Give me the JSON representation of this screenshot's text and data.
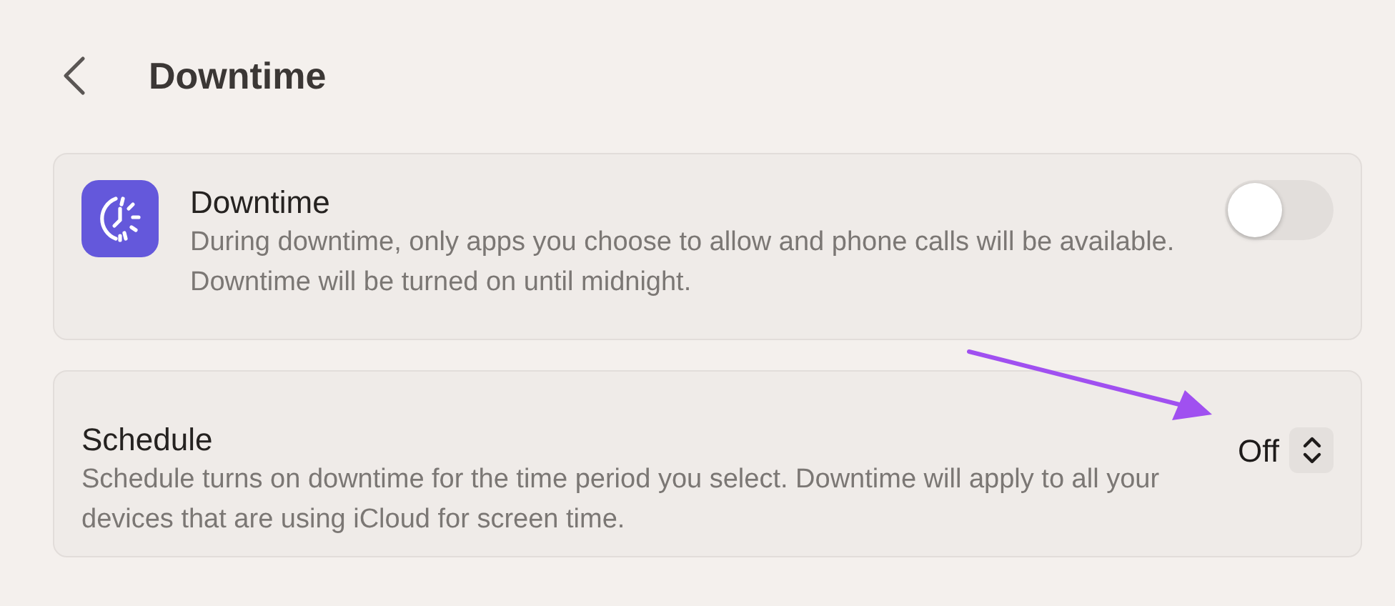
{
  "header": {
    "title": "Downtime"
  },
  "settings": [
    {
      "kind": "toggle",
      "title": "Downtime",
      "description": "During downtime, only apps you choose to allow and phone calls will be available. Downtime will be turned on until midnight.",
      "on": false
    },
    {
      "kind": "popup",
      "title": "Schedule",
      "description": "Schedule turns on downtime for the time period you select. Downtime will apply to all your devices that are using iCloud for screen time.",
      "value": "Off"
    }
  ]
}
